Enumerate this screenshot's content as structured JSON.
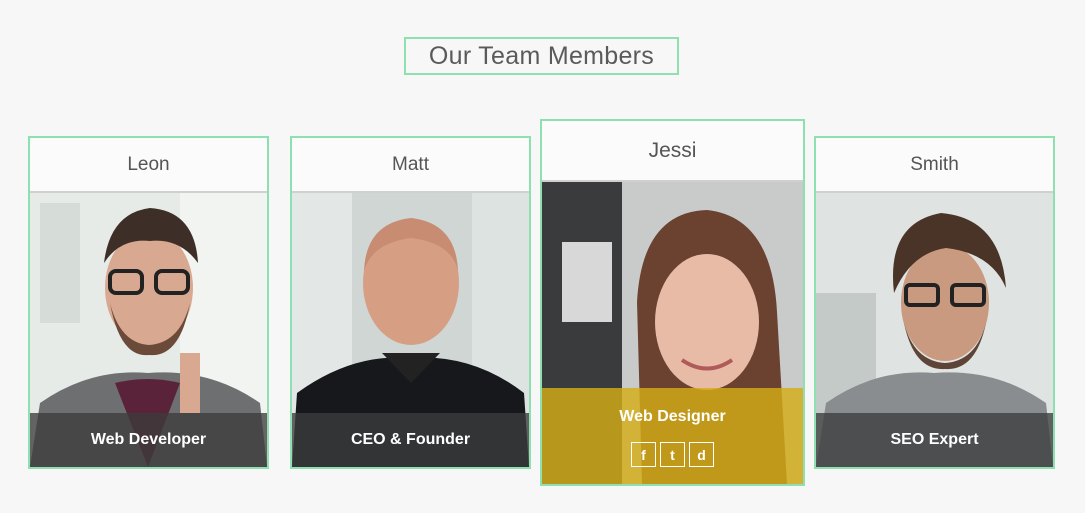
{
  "section": {
    "title": "Our Team Members"
  },
  "members": [
    {
      "name": "Leon",
      "role": "Web Developer"
    },
    {
      "name": "Matt",
      "role": "CEO & Founder"
    },
    {
      "name": "Jessi",
      "role": "Web Designer",
      "social": {
        "facebook": "f",
        "twitter": "t",
        "dribbble": "d"
      }
    },
    {
      "name": "Smith",
      "role": "SEO Expert"
    }
  ],
  "colors": {
    "accent_border": "#8fe0b0",
    "highlight": "#d4ac16",
    "overlay": "#3c3c3c"
  },
  "icons": [
    "facebook-icon",
    "twitter-icon",
    "dribbble-icon"
  ]
}
